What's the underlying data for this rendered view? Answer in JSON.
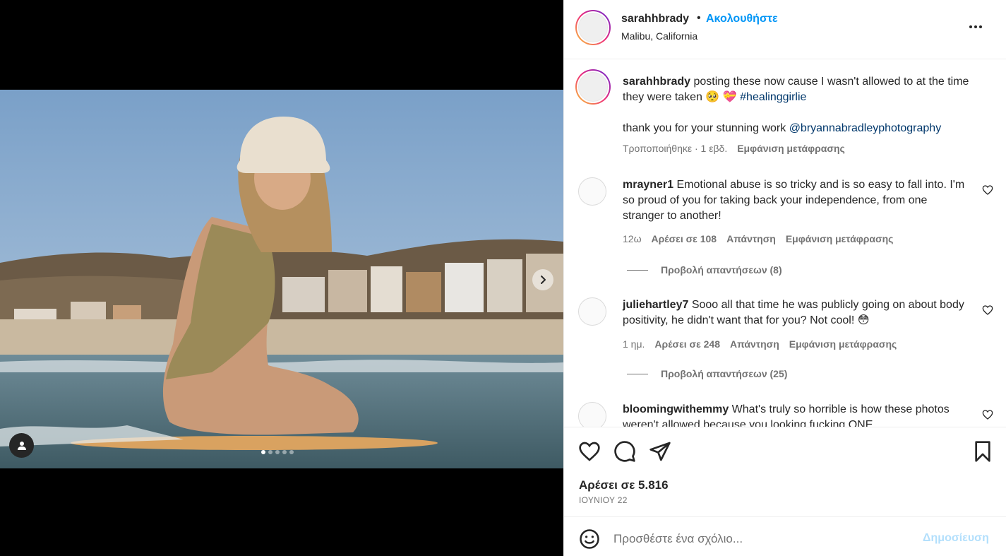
{
  "header": {
    "username": "sarahhbrady",
    "separator": "•",
    "follow_label": "Ακολουθήστε",
    "location": "Malibu, California"
  },
  "caption": {
    "username": "sarahhbrady",
    "text": " posting these now cause I wasn't allowed to at the time they were taken 🥺 💝 ",
    "hashtag": "#healinggirlie",
    "thanks": "thank you for your stunning work ",
    "mention": "@bryannabradleyphotography",
    "edited": "Τροποποιήθηκε · 1 εβδ.",
    "translate": "Εμφάνιση μετάφρασης"
  },
  "comments": [
    {
      "username": "mrayner1",
      "text": " Emotional abuse is so tricky and is so easy to fall into. I'm so proud of you for taking back your independence, from one stranger to another!",
      "age": "12ω",
      "likes": "Αρέσει σε 108",
      "reply": "Απάντηση",
      "translate": "Εμφάνιση μετάφρασης",
      "view_replies": "Προβολή απαντήσεων (8)"
    },
    {
      "username": "juliehartley7",
      "text": " Sooo all that time he was publicly going on about body positivity, he didn't want that for you? Not cool! 😳",
      "age": "1 ημ.",
      "likes": "Αρέσει σε 248",
      "reply": "Απάντηση",
      "translate": "Εμφάνιση μετάφρασης",
      "view_replies": "Προβολή απαντήσεων (25)"
    },
    {
      "username": "bloomingwithemmy",
      "text": " What's truly so horrible is how these photos weren't allowed because you looking fucking ONE"
    }
  ],
  "actions": {
    "likes": "Αρέσει σε 5.816",
    "date": "ΙΟΥΝΙΟΥ 22"
  },
  "add_comment": {
    "placeholder": "Προσθέστε ένα σχόλιο...",
    "post_label": "Δημοσίευση"
  },
  "carousel": {
    "slide_count": 5,
    "active_index": 0
  },
  "icons": {
    "next": "chevron-right-icon",
    "user_tag": "user-icon",
    "more": "more-options-icon",
    "like": "heart-icon",
    "comment": "comment-icon",
    "share": "share-icon",
    "save": "bookmark-icon",
    "emoji": "emoji-icon"
  },
  "colors": {
    "accent": "#0095f6",
    "text": "#262626",
    "secondary": "#737373",
    "link": "#00376b"
  }
}
